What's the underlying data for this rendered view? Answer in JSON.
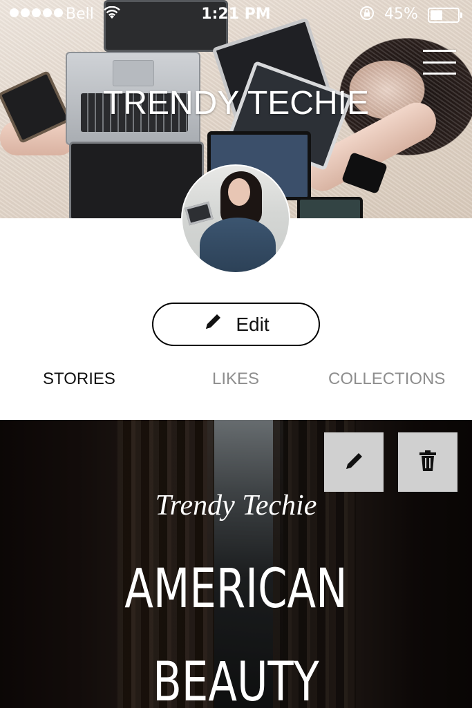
{
  "status_bar": {
    "carrier": "Bell",
    "time": "1:21 PM",
    "battery_percent": "45%",
    "battery_level": 0.45,
    "signal_dots": 5
  },
  "header": {
    "profile_name": "TRENDY TECHIE",
    "menu_icon": "hamburger-menu-icon"
  },
  "profile": {
    "edit_label": "Edit",
    "edit_icon": "pencil-icon"
  },
  "tabs": [
    {
      "label": "STORIES",
      "active": true
    },
    {
      "label": "LIKES",
      "active": false
    },
    {
      "label": "COLLECTIONS",
      "active": false
    }
  ],
  "story": {
    "author": "Trendy Techie",
    "title": "AMERICAN BEAUTY",
    "actions": [
      {
        "icon": "pencil-icon"
      },
      {
        "icon": "trash-icon"
      }
    ]
  },
  "colors": {
    "active_tab": "#111111",
    "inactive_tab": "#8e8e8e",
    "action_button_bg": "#d0d0d0"
  }
}
